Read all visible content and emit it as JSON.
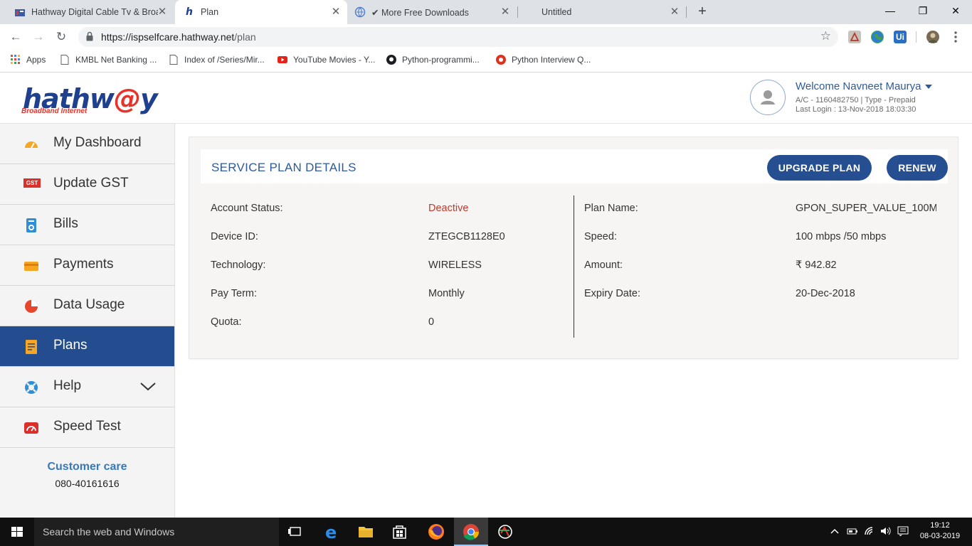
{
  "browser": {
    "tabs": [
      {
        "title": "Hathway Digital Cable Tv & Broa",
        "active": false
      },
      {
        "title": "Plan",
        "active": true
      },
      {
        "title": "More Free Downloads",
        "active": false
      },
      {
        "title": "Untitled",
        "active": false
      }
    ],
    "new_tab": "+",
    "url_host": "https://ispselfcare.hathway.net",
    "url_path": "/plan",
    "bookmarks": [
      "Apps",
      "KMBL Net Banking ...",
      "Index of /Series/Mir...",
      "YouTube Movies - Y...",
      "Python-programmi...",
      "Python Interview Q..."
    ]
  },
  "header": {
    "logo_text": "hathw",
    "logo_at": "@",
    "logo_end": "y",
    "logo_tagline": "Broadband Internet",
    "welcome": "Welcome Navneet Maurya",
    "account_line": "A/C - 1160482750 | Type - Prepaid",
    "last_login": "Last Login : 13-Nov-2018 18:03:30"
  },
  "sidebar": {
    "items": [
      {
        "label": "My Dashboard",
        "icon": "dashboard-icon"
      },
      {
        "label": "Update GST",
        "icon": "gst-icon"
      },
      {
        "label": "Bills",
        "icon": "bill-icon"
      },
      {
        "label": "Payments",
        "icon": "payment-card-icon"
      },
      {
        "label": "Data Usage",
        "icon": "pie-chart-icon"
      },
      {
        "label": "Plans",
        "icon": "plans-icon"
      },
      {
        "label": "Help",
        "icon": "lifebuoy-icon"
      },
      {
        "label": "Speed Test",
        "icon": "speedometer-icon"
      }
    ],
    "gst_badge": "GST",
    "customer_care_title": "Customer care",
    "customer_care_phone": "080-40161616"
  },
  "plan": {
    "title": "SERVICE PLAN DETAILS",
    "upgrade_label": "UPGRADE PLAN",
    "renew_label": "RENEW",
    "left": [
      {
        "label": "Account Status:",
        "value": "Deactive"
      },
      {
        "label": "Device ID:",
        "value": "ZTEGCB1128E0"
      },
      {
        "label": "Technology:",
        "value": "WIRELESS"
      },
      {
        "label": "Pay Term:",
        "value": "Monthly"
      },
      {
        "label": "Quota:",
        "value": "0"
      }
    ],
    "right": [
      {
        "label": "Plan Name:",
        "value": "GPON_SUPER_VALUE_100M"
      },
      {
        "label": "Speed:",
        "value": "100 mbps /50 mbps"
      },
      {
        "label": "Amount:",
        "value": "₹ 942.82"
      },
      {
        "label": "Expiry Date:",
        "value": "20-Dec-2018"
      }
    ]
  },
  "taskbar": {
    "search_placeholder": "Search the web and Windows",
    "time": "19:12",
    "date": "08-03-2019"
  },
  "colors": {
    "brand_blue": "#234d8f",
    "status_red": "#c0392b",
    "link_blue": "#3a78b8"
  }
}
